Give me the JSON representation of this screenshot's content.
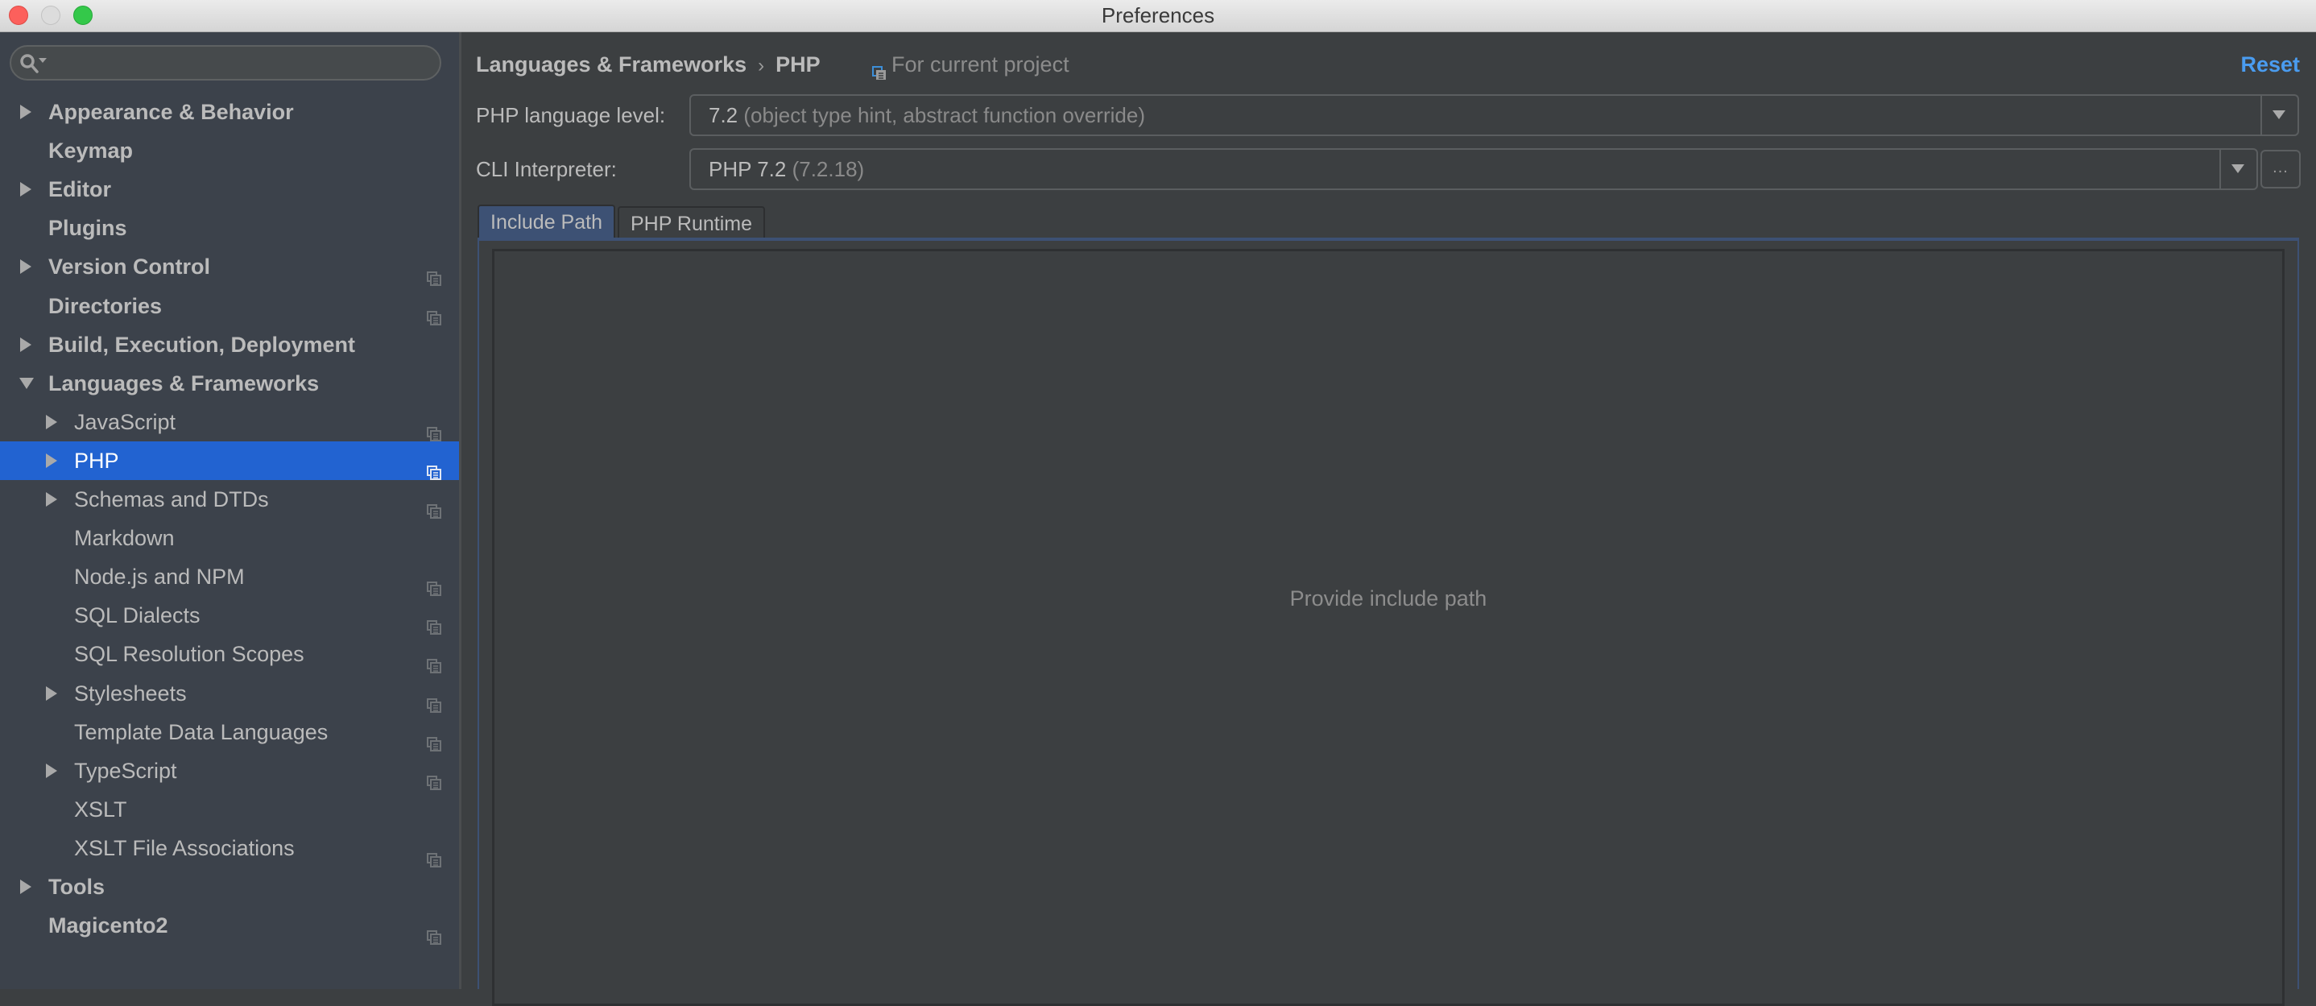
{
  "window": {
    "title": "Preferences"
  },
  "sidebar": {
    "search": {
      "value": "",
      "placeholder": ""
    },
    "items": [
      {
        "label": "Appearance & Behavior",
        "level": 0,
        "expandable": true,
        "expanded": false,
        "bold": true,
        "project_icon": false
      },
      {
        "label": "Keymap",
        "level": 0,
        "expandable": false,
        "bold": true,
        "project_icon": false
      },
      {
        "label": "Editor",
        "level": 0,
        "expandable": true,
        "expanded": false,
        "bold": true,
        "project_icon": false
      },
      {
        "label": "Plugins",
        "level": 0,
        "expandable": false,
        "bold": true,
        "project_icon": false
      },
      {
        "label": "Version Control",
        "level": 0,
        "expandable": true,
        "expanded": false,
        "bold": true,
        "project_icon": true
      },
      {
        "label": "Directories",
        "level": 0,
        "expandable": false,
        "bold": true,
        "project_icon": true
      },
      {
        "label": "Build, Execution, Deployment",
        "level": 0,
        "expandable": true,
        "expanded": false,
        "bold": true,
        "project_icon": false
      },
      {
        "label": "Languages & Frameworks",
        "level": 0,
        "expandable": true,
        "expanded": true,
        "bold": true,
        "project_icon": false
      },
      {
        "label": "JavaScript",
        "level": 1,
        "expandable": true,
        "expanded": false,
        "bold": false,
        "project_icon": true
      },
      {
        "label": "PHP",
        "level": 1,
        "expandable": true,
        "expanded": false,
        "bold": false,
        "project_icon": true,
        "selected": true
      },
      {
        "label": "Schemas and DTDs",
        "level": 1,
        "expandable": true,
        "expanded": false,
        "bold": false,
        "project_icon": true
      },
      {
        "label": "Markdown",
        "level": 1,
        "expandable": false,
        "bold": false,
        "project_icon": false
      },
      {
        "label": "Node.js and NPM",
        "level": 1,
        "expandable": false,
        "bold": false,
        "project_icon": true
      },
      {
        "label": "SQL Dialects",
        "level": 1,
        "expandable": false,
        "bold": false,
        "project_icon": true
      },
      {
        "label": "SQL Resolution Scopes",
        "level": 1,
        "expandable": false,
        "bold": false,
        "project_icon": true
      },
      {
        "label": "Stylesheets",
        "level": 1,
        "expandable": true,
        "expanded": false,
        "bold": false,
        "project_icon": true
      },
      {
        "label": "Template Data Languages",
        "level": 1,
        "expandable": false,
        "bold": false,
        "project_icon": true
      },
      {
        "label": "TypeScript",
        "level": 1,
        "expandable": true,
        "expanded": false,
        "bold": false,
        "project_icon": true
      },
      {
        "label": "XSLT",
        "level": 1,
        "expandable": false,
        "bold": false,
        "project_icon": false
      },
      {
        "label": "XSLT File Associations",
        "level": 1,
        "expandable": false,
        "bold": false,
        "project_icon": true
      },
      {
        "label": "Tools",
        "level": 0,
        "expandable": true,
        "expanded": false,
        "bold": true,
        "project_icon": false
      },
      {
        "label": "Magicento2",
        "level": 0,
        "expandable": false,
        "bold": true,
        "project_icon": true
      }
    ]
  },
  "header": {
    "breadcrumb": [
      "Languages & Frameworks",
      "PHP"
    ],
    "breadcrumb_separator": "›",
    "scope_label": "For current project",
    "reset_label": "Reset"
  },
  "form": {
    "language_level": {
      "label": "PHP language level:",
      "value": "7.2",
      "hint": "(object type hint, abstract function override)"
    },
    "cli_interpreter": {
      "label": "CLI Interpreter:",
      "value": "PHP 7.2",
      "hint": "(7.2.18)",
      "more_label": "..."
    }
  },
  "tabs": [
    {
      "label": "Include Path",
      "active": true
    },
    {
      "label": "PHP Runtime",
      "active": false
    }
  ],
  "include_path": {
    "empty_text": "Provide include path"
  },
  "colors": {
    "accent": "#2263d1",
    "link": "#4a9cf0",
    "tab_active": "#3d5174",
    "sidebar_bg": "#3c424b",
    "main_bg": "#3c3f41"
  }
}
